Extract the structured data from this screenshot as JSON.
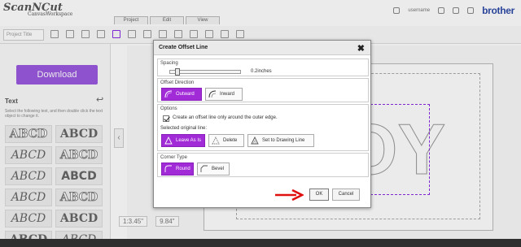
{
  "app": {
    "logo": "ScanNCut",
    "logo_sub": "CanvasWorkspace",
    "tabs": [
      "Project",
      "Edit",
      "View"
    ],
    "user_label": "username",
    "brand": "brother",
    "project_title_placeholder": "Project Title"
  },
  "left_panel": {
    "download_label": "Download",
    "text_heading": "Text",
    "hint": "Select the following text, and then double click the text object to change it.",
    "font_samples": [
      "ABCD",
      "ABCD",
      "ABCD",
      "ABCD",
      "ABCD",
      "ABCD",
      "ABCD",
      "ABCD",
      "ABCD",
      "ABCD",
      "ABCD",
      "ABCD"
    ]
  },
  "canvas": {
    "design_text": "OY",
    "coord_width": "1:3.45\"",
    "coord_height": "9.84\""
  },
  "dialog": {
    "title": "Create Offset Line",
    "spacing": {
      "title": "Spacing",
      "value": "0.2inches",
      "slider_fraction": 0.08
    },
    "offset_direction": {
      "title": "Offset Direction",
      "options": [
        "Outward",
        "Inward"
      ],
      "selected": "Outward"
    },
    "options": {
      "title": "Options",
      "checkbox_label": "Create an offset line only around the outer edge.",
      "checkbox_checked": true,
      "selected_original_label": "Selected original line:",
      "original_line_options": [
        "Leave As Is",
        "Delete",
        "Set to Drawing Line"
      ],
      "original_line_selected": "Leave As Is"
    },
    "corner_type": {
      "title": "Corner Type",
      "options": [
        "Round",
        "Bevel"
      ],
      "selected": "Round"
    },
    "ok_label": "OK",
    "cancel_label": "Cancel"
  },
  "colors": {
    "accent_purple": "#a12bd6",
    "annotation_arrow": "#e01010",
    "brand_blue": "#2e4aa7"
  }
}
